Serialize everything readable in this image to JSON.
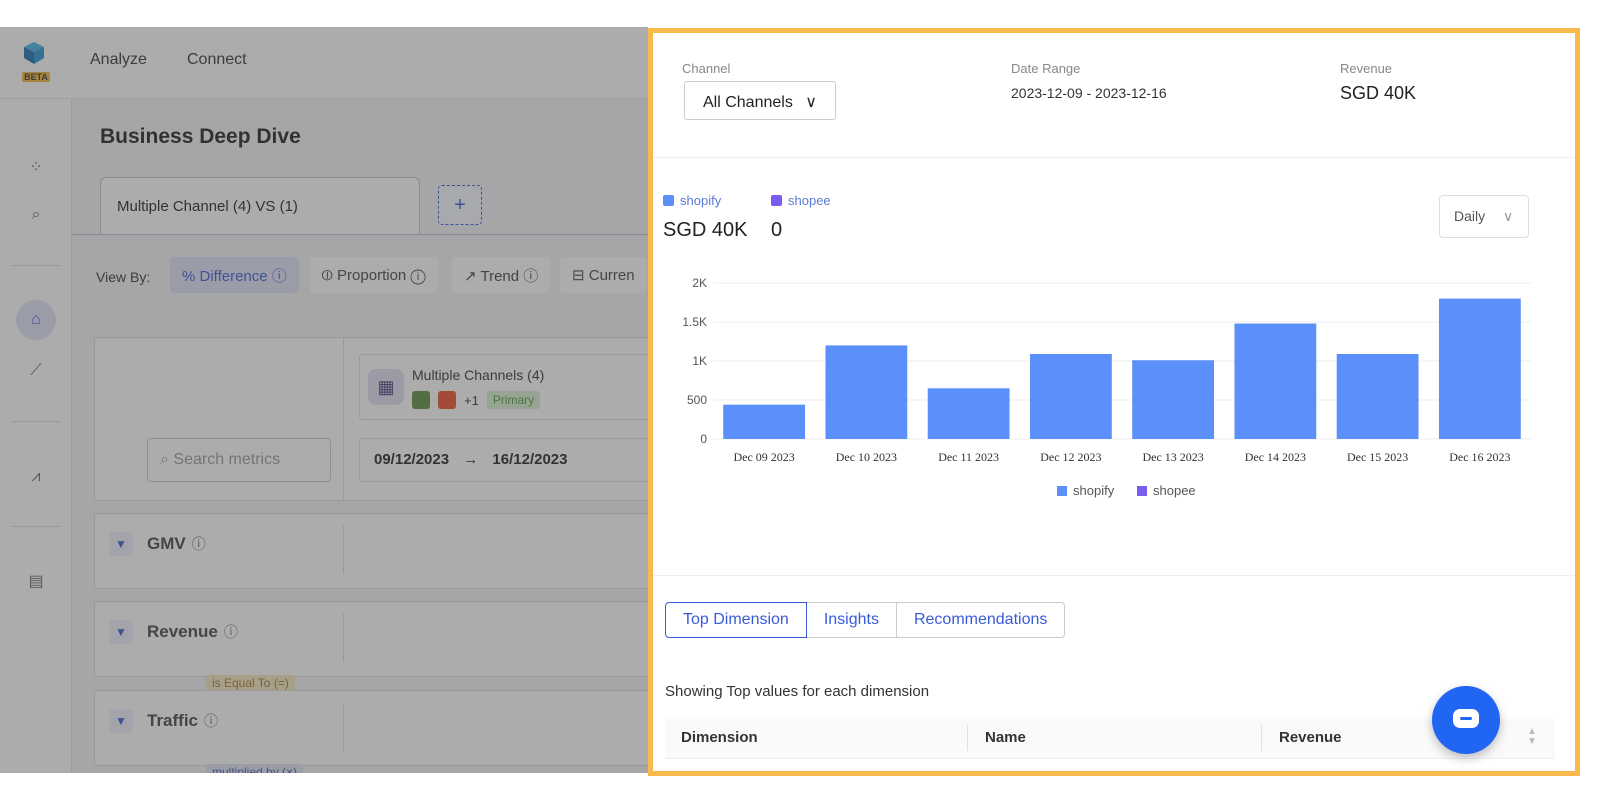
{
  "app": {
    "logo_badge": "BETA",
    "nav": [
      "Analyze",
      "Connect"
    ],
    "page_title": "Business Deep Dive",
    "tab_label": "Multiple Channel (4) VS (1)",
    "add_tab_label": "+",
    "view_by_label": "View By:",
    "view_options": [
      "% Difference ⓘ",
      "⦶ Proportion ⓘ",
      "↗ Trend ⓘ",
      "⊟ Curren"
    ],
    "search_placeholder": "Search metrics",
    "channel_card": {
      "title": "Multiple Channels (4)",
      "extra_count": "+1",
      "badge": "Primary"
    },
    "date_from": "09/12/2023",
    "date_arrow": "→",
    "date_to": "16/12/2023",
    "metrics": [
      "GMV",
      "Revenue",
      "Traffic"
    ],
    "relations": [
      "is Equal To (=)",
      "multiplied by (×)"
    ]
  },
  "drawer": {
    "channel_label": "Channel",
    "channel_value": "All Channels",
    "date_range_label": "Date Range",
    "date_range_value": "2023-12-09 - 2023-12-16",
    "revenue_label": "Revenue",
    "revenue_value": "SGD 40K",
    "legend": [
      {
        "name": "shopify",
        "value": "SGD 40K",
        "color": "#5b8ff9"
      },
      {
        "name": "shopee",
        "value": "0",
        "color": "#7b5cf0"
      }
    ],
    "granularity": "Daily",
    "tabs": [
      "Top Dimension",
      "Insights",
      "Recommendations"
    ],
    "showing_text": "Showing Top values for each dimension",
    "table_headers": [
      "Dimension",
      "Name",
      "Revenue"
    ]
  },
  "chart_data": {
    "type": "bar",
    "categories": [
      "Dec 09 2023",
      "Dec 10 2023",
      "Dec 11 2023",
      "Dec 12 2023",
      "Dec 13 2023",
      "Dec 14 2023",
      "Dec 15 2023",
      "Dec 16 2023"
    ],
    "series": [
      {
        "name": "shopify",
        "color": "#5b8ff9",
        "values": [
          440,
          1200,
          650,
          1090,
          1010,
          1480,
          1090,
          1800
        ]
      },
      {
        "name": "shopee",
        "color": "#7b5cf0",
        "values": [
          0,
          0,
          0,
          0,
          0,
          0,
          0,
          0
        ]
      }
    ],
    "y_ticks": [
      0,
      500,
      1000,
      1500,
      2000
    ],
    "y_tick_labels": [
      "0",
      "500",
      "1K",
      "1.5K",
      "2K"
    ],
    "ylim": [
      0,
      2000
    ],
    "grid": true,
    "legend_position": "bottom-center"
  }
}
